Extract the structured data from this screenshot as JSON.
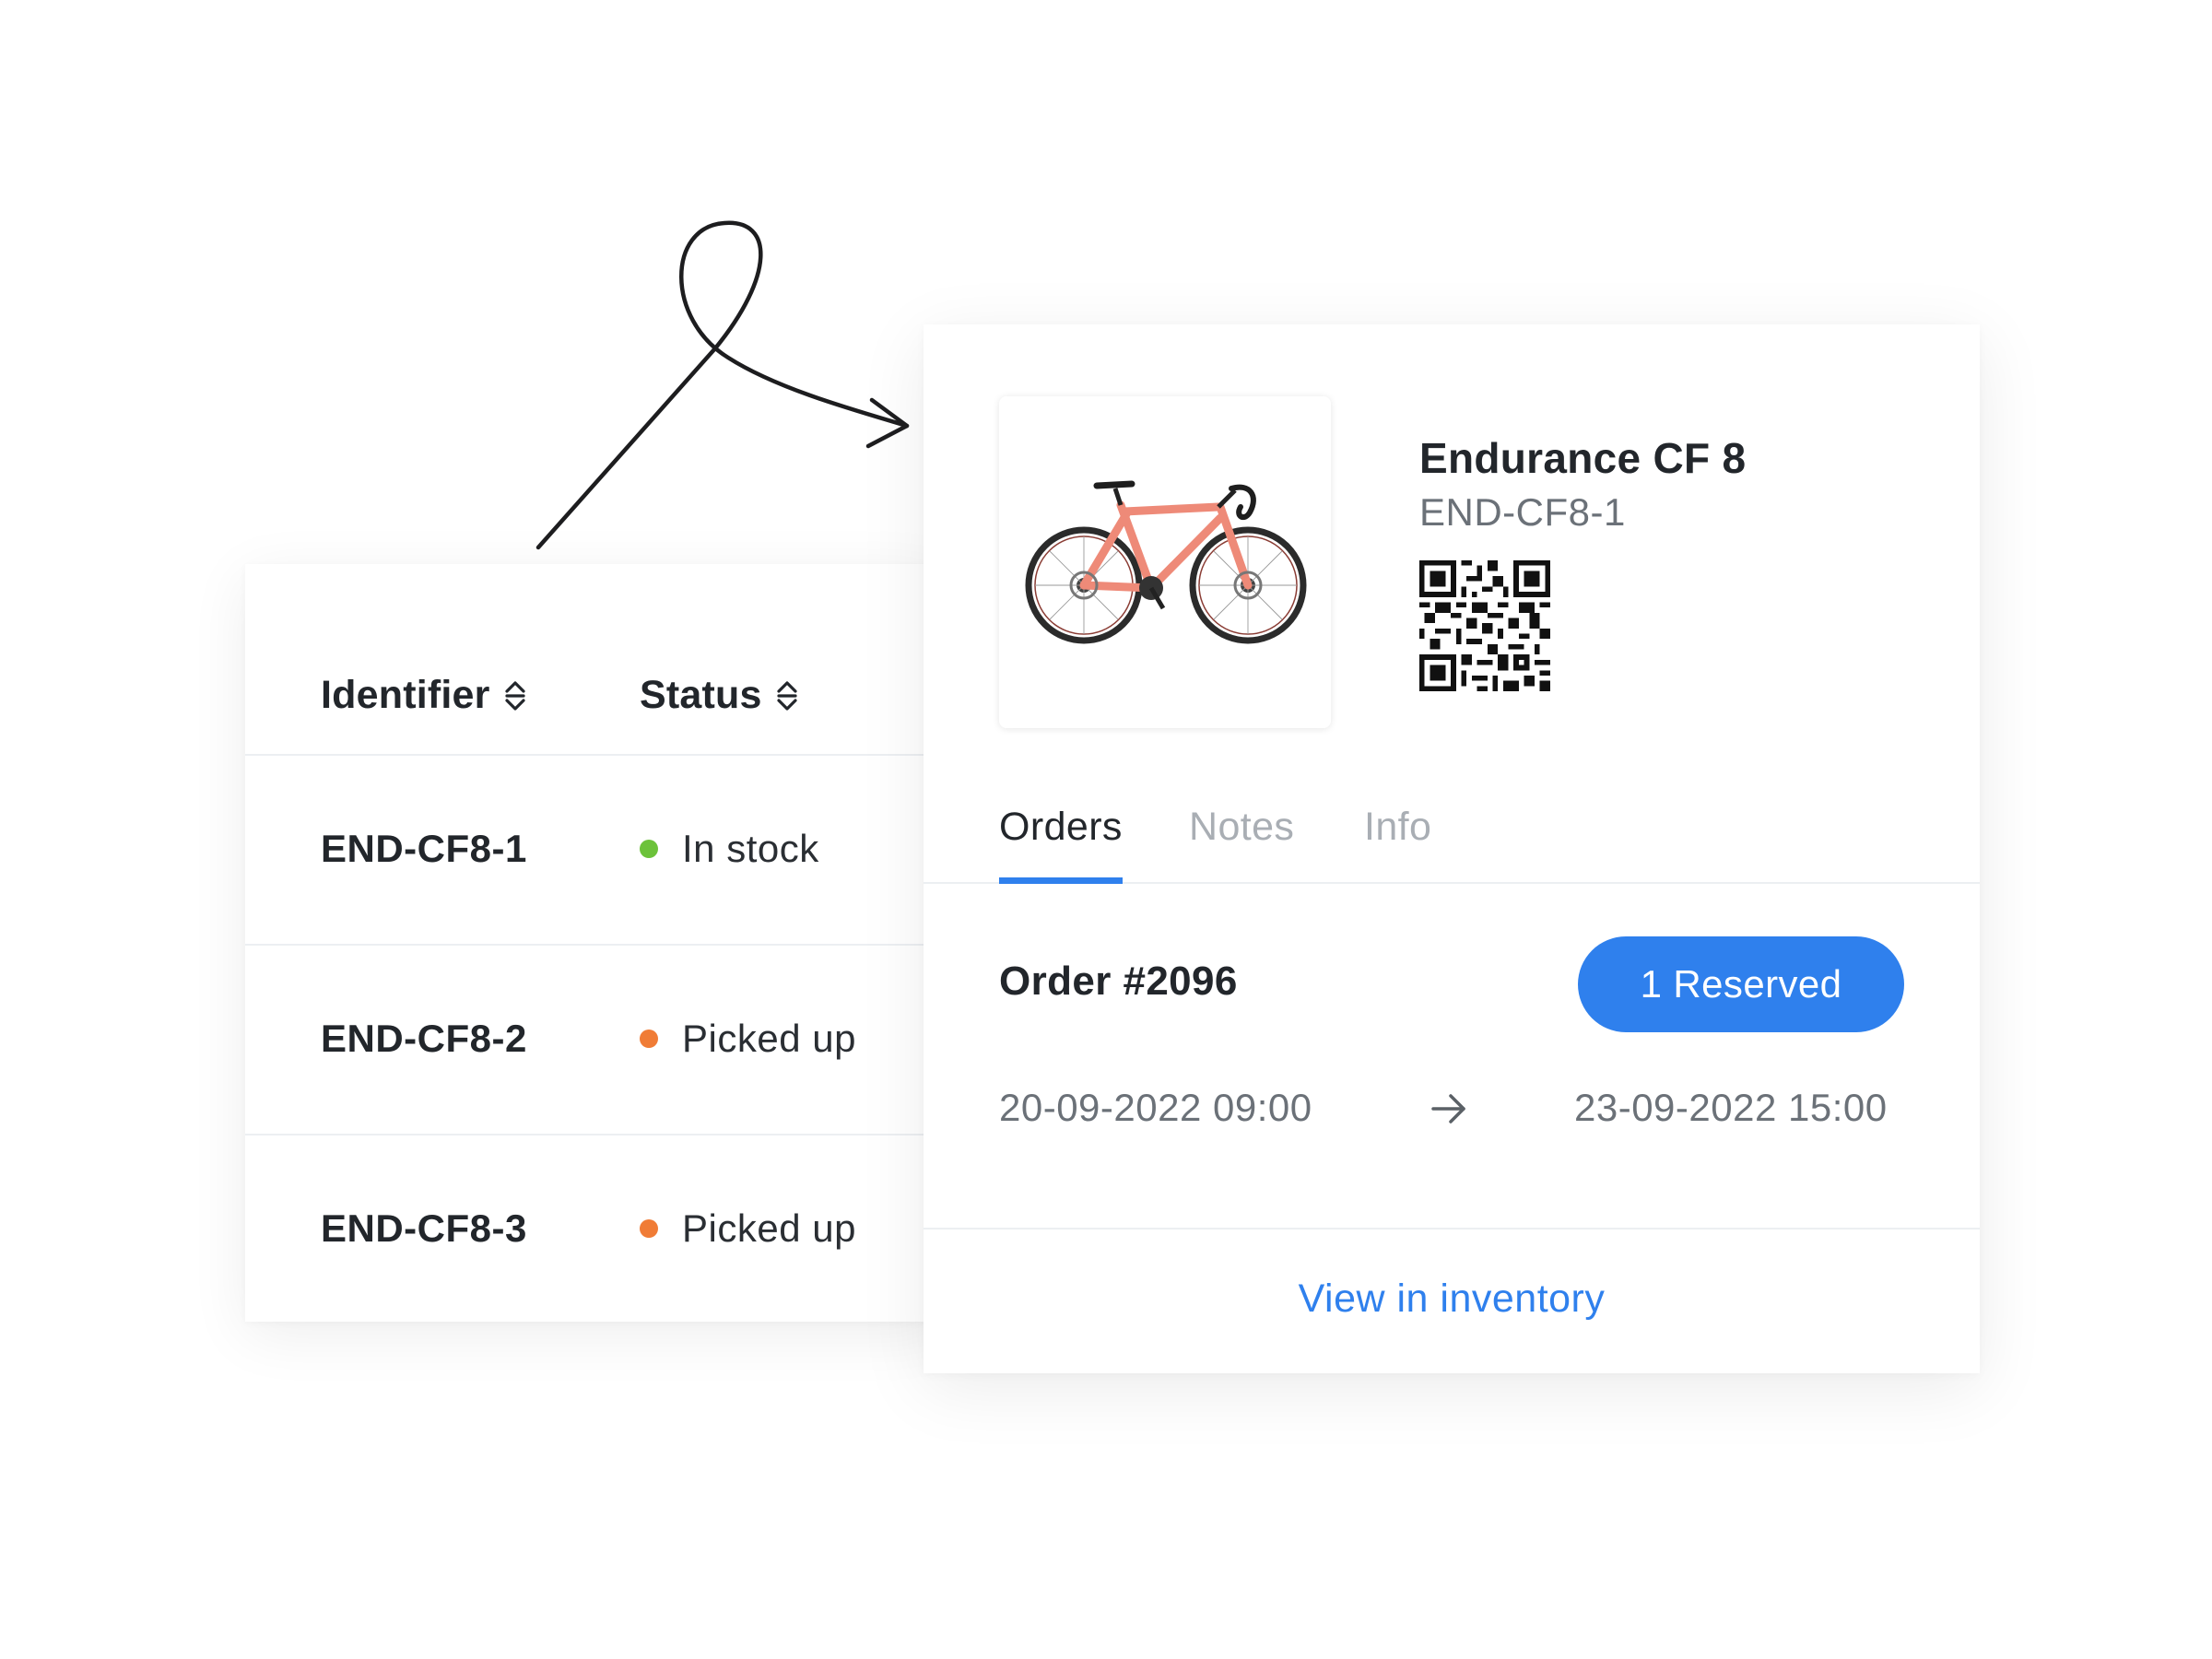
{
  "table": {
    "headers": {
      "identifier": "Identifier",
      "status": "Status"
    },
    "rows": [
      {
        "identifier": "END-CF8-1",
        "status": "In stock",
        "status_color": "#6cc23a"
      },
      {
        "identifier": "END-CF8-2",
        "status": "Picked up",
        "status_color": "#f07c36"
      },
      {
        "identifier": "END-CF8-3",
        "status": "Picked up",
        "status_color": "#f07c36"
      }
    ]
  },
  "detail": {
    "title": "Endurance CF 8",
    "sku": "END-CF8-1",
    "image_icon": "road-bike-icon",
    "qr_icon": "qr-code-icon",
    "tabs": [
      {
        "label": "Orders",
        "active": true
      },
      {
        "label": "Notes",
        "active": false
      },
      {
        "label": "Info",
        "active": false
      }
    ],
    "order": {
      "title": "Order #2096",
      "badge": "1 Reserved",
      "start": "20-09-2022 09:00",
      "end": "23-09-2022 15:00"
    },
    "footer_link": "View in inventory"
  },
  "colors": {
    "accent": "#2f80ed",
    "in_stock": "#6cc23a",
    "picked_up": "#f07c36"
  }
}
